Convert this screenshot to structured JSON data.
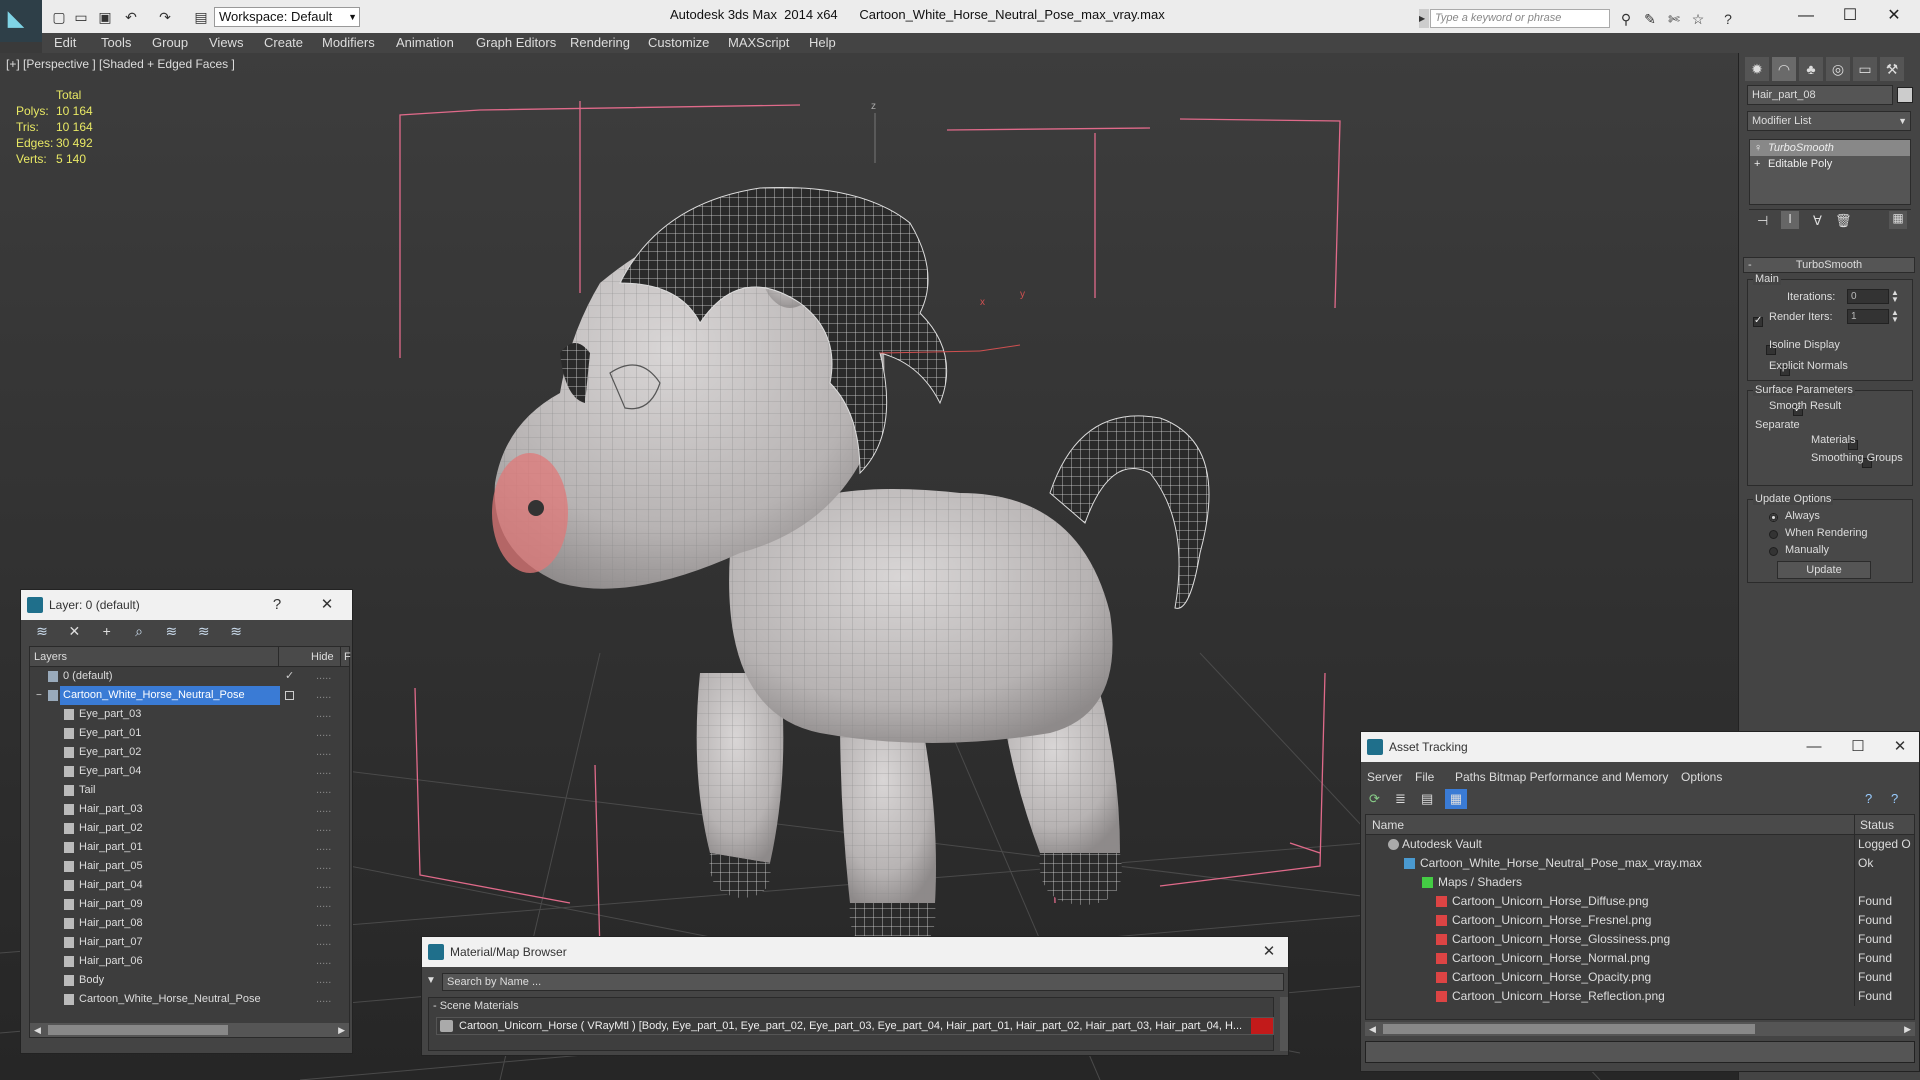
{
  "app": {
    "title": "Autodesk 3ds Max  2014 x64      Cartoon_White_Horse_Neutral_Pose_max_vray.max",
    "workspace": "Workspace: Default",
    "search_placeholder": "Type a keyword or phrase"
  },
  "menu": [
    "Edit",
    "Tools",
    "Group",
    "Views",
    "Create",
    "Modifiers",
    "Animation",
    "Graph Editors",
    "Rendering",
    "Customize",
    "MAXScript",
    "Help"
  ],
  "viewport": {
    "label": "[+] [Perspective ] [Shaded + Edged Faces ]",
    "stats": {
      "header": "Total",
      "rows": [
        {
          "label": "Polys:",
          "value": "10 164"
        },
        {
          "label": "Tris:",
          "value": "10 164"
        },
        {
          "label": "Edges:",
          "value": "30 492"
        },
        {
          "label": "Verts:",
          "value": "5 140"
        }
      ]
    },
    "gizmo_x": "x",
    "gizmo_y": "y",
    "gizmo_z": "z"
  },
  "command_panel": {
    "object_name": "Hair_part_08",
    "modifier_list": "Modifier List",
    "stack": [
      "TurboSmooth",
      "Editable Poly"
    ],
    "rollout_title": "TurboSmooth",
    "main_label": "Main",
    "iterations_label": "Iterations:",
    "iterations_value": "0",
    "render_iters_label": "Render Iters:",
    "render_iters_value": "1",
    "isoline_label": "Isoline Display",
    "explicit_normals_label": "Explicit Normals",
    "surface_params_label": "Surface Parameters",
    "smooth_result_label": "Smooth Result",
    "separate_label": "Separate",
    "materials_label": "Materials",
    "smoothing_groups_label": "Smoothing Groups",
    "update_options_label": "Update Options",
    "always_label": "Always",
    "when_rendering_label": "When Rendering",
    "manually_label": "Manually",
    "update_button": "Update"
  },
  "layer_window": {
    "title": "Layer: 0 (default)",
    "help": "?",
    "col_layers": "Layers",
    "col_hide": "Hide",
    "col_f": "F",
    "rows": [
      {
        "name": "0 (default)",
        "indent": 0
      },
      {
        "name": "Cartoon_White_Horse_Neutral_Pose",
        "indent": 0
      },
      {
        "name": "Eye_part_03",
        "indent": 1
      },
      {
        "name": "Eye_part_01",
        "indent": 1
      },
      {
        "name": "Eye_part_02",
        "indent": 1
      },
      {
        "name": "Eye_part_04",
        "indent": 1
      },
      {
        "name": "Tail",
        "indent": 1
      },
      {
        "name": "Hair_part_03",
        "indent": 1
      },
      {
        "name": "Hair_part_02",
        "indent": 1
      },
      {
        "name": "Hair_part_01",
        "indent": 1
      },
      {
        "name": "Hair_part_05",
        "indent": 1
      },
      {
        "name": "Hair_part_04",
        "indent": 1
      },
      {
        "name": "Hair_part_09",
        "indent": 1
      },
      {
        "name": "Hair_part_08",
        "indent": 1
      },
      {
        "name": "Hair_part_07",
        "indent": 1
      },
      {
        "name": "Hair_part_06",
        "indent": 1
      },
      {
        "name": "Body",
        "indent": 1
      },
      {
        "name": "Cartoon_White_Horse_Neutral_Pose",
        "indent": 1
      }
    ],
    "dots": "....."
  },
  "material_browser": {
    "title": "Material/Map Browser",
    "search_label": "Search by Name ...",
    "group_label": "- Scene Materials",
    "material_entry": "Cartoon_Unicorn_Horse  ( VRayMtl )  [Body, Eye_part_01, Eye_part_02, Eye_part_03, Eye_part_04, Hair_part_01, Hair_part_02, Hair_part_03, Hair_part_04, H..."
  },
  "asset_tracking": {
    "title": "Asset Tracking",
    "menu": [
      "Server",
      "File",
      "Paths",
      "Bitmap Performance and Memory",
      "Options"
    ],
    "col_name": "Name",
    "col_status": "Status",
    "rows": [
      {
        "name": "Autodesk Vault",
        "status": "Logged O",
        "indent": 1
      },
      {
        "name": "Cartoon_White_Horse_Neutral_Pose_max_vray.max",
        "status": "Ok",
        "indent": 2
      },
      {
        "name": "Maps / Shaders",
        "status": "",
        "indent": 3
      },
      {
        "name": "Cartoon_Unicorn_Horse_Diffuse.png",
        "status": "Found",
        "indent": 4
      },
      {
        "name": "Cartoon_Unicorn_Horse_Fresnel.png",
        "status": "Found",
        "indent": 4
      },
      {
        "name": "Cartoon_Unicorn_Horse_Glossiness.png",
        "status": "Found",
        "indent": 4
      },
      {
        "name": "Cartoon_Unicorn_Horse_Normal.png",
        "status": "Found",
        "indent": 4
      },
      {
        "name": "Cartoon_Unicorn_Horse_Opacity.png",
        "status": "Found",
        "indent": 4
      },
      {
        "name": "Cartoon_Unicorn_Horse_Reflection.png",
        "status": "Found",
        "indent": 4
      }
    ]
  },
  "colors": {
    "selection": "#3a7bd5",
    "stats_text": "#e8e864",
    "bbox": "#e06a8a"
  }
}
